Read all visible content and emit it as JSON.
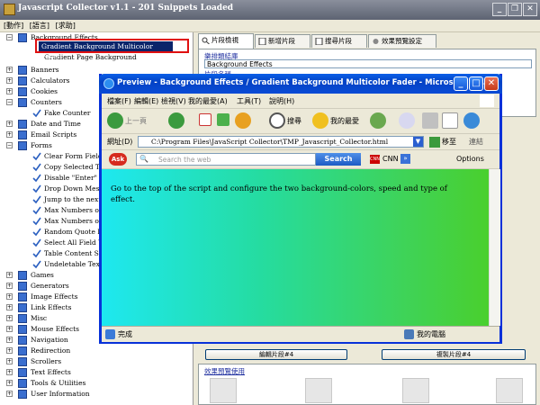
{
  "main_window": {
    "title": "Javascript Collector v1.1  -  201 Snippets Loaded",
    "controls": [
      "_",
      "❐",
      "✕"
    ]
  },
  "menubar": [
    "[動作]",
    "[語言]",
    "[求助]"
  ],
  "tree": {
    "partial_top": "Background Effects",
    "selected": "Gradient Background Multicolor Fader",
    "partial_below": "Gradient Page  Background",
    "categories_a": [
      "Banners",
      "Calculators",
      "Cookies",
      "Counters"
    ],
    "counters_child": "Fake Counter",
    "categories_b": [
      "Date and Time",
      "Email Scripts",
      "Forms"
    ],
    "forms_children": [
      "Clear Form Field",
      "Copy Selected Te",
      "Disable \"Enter\" K",
      "Drop Down Mess",
      "Jump to the next f",
      "Max Numbers of",
      "Max Numbers of",
      "Random Quote In",
      "Select All Field Va",
      "Table Content Scr",
      "Undeletable Text"
    ],
    "categories_c": [
      "Games",
      "Generators",
      "Image Effects",
      "Link Effects",
      "Misc",
      "Mouse Effects",
      "Navigation",
      "Redirection",
      "Scrollers",
      "Text Effects",
      "Tools & Utilities",
      "User Information"
    ]
  },
  "right_panel": {
    "tabs": [
      "片段檢視",
      "新增片段",
      "搜尋片段",
      "效果預覽設定"
    ],
    "section_link": "樂排類結庫",
    "category_value": "Background Effects",
    "partial_link": "片段名稱",
    "buttons": {
      "edit": "編輯片段#4",
      "copy": "複製片段#4"
    },
    "preview_link": "效果預覽使用"
  },
  "ie": {
    "title": "Preview - Background Effects / Gradient Background Multicolor Fader - Microsoft Int...",
    "menu": [
      "檔案(F)",
      "編輯(E)",
      "檢視(V)",
      "我的最愛(A)",
      "工具(T)",
      "說明(H)"
    ],
    "toolbar": {
      "back": "上一頁",
      "search": "搜尋",
      "favorites": "我的最愛"
    },
    "address_label": "網址(D)",
    "address": "C:\\Program Files\\JavaScript Collector\\TMP_Javascript_Collector.html",
    "go": "移至",
    "links": "連結",
    "ask": {
      "placeholder": "Search the web",
      "button": "Search",
      "cnn": "CNN",
      "options": "Options"
    },
    "message": "Go to the top of the script and configure the two background-colors, speed and type of effect.",
    "status_done": "完成",
    "status_zone": "我的電腦"
  }
}
